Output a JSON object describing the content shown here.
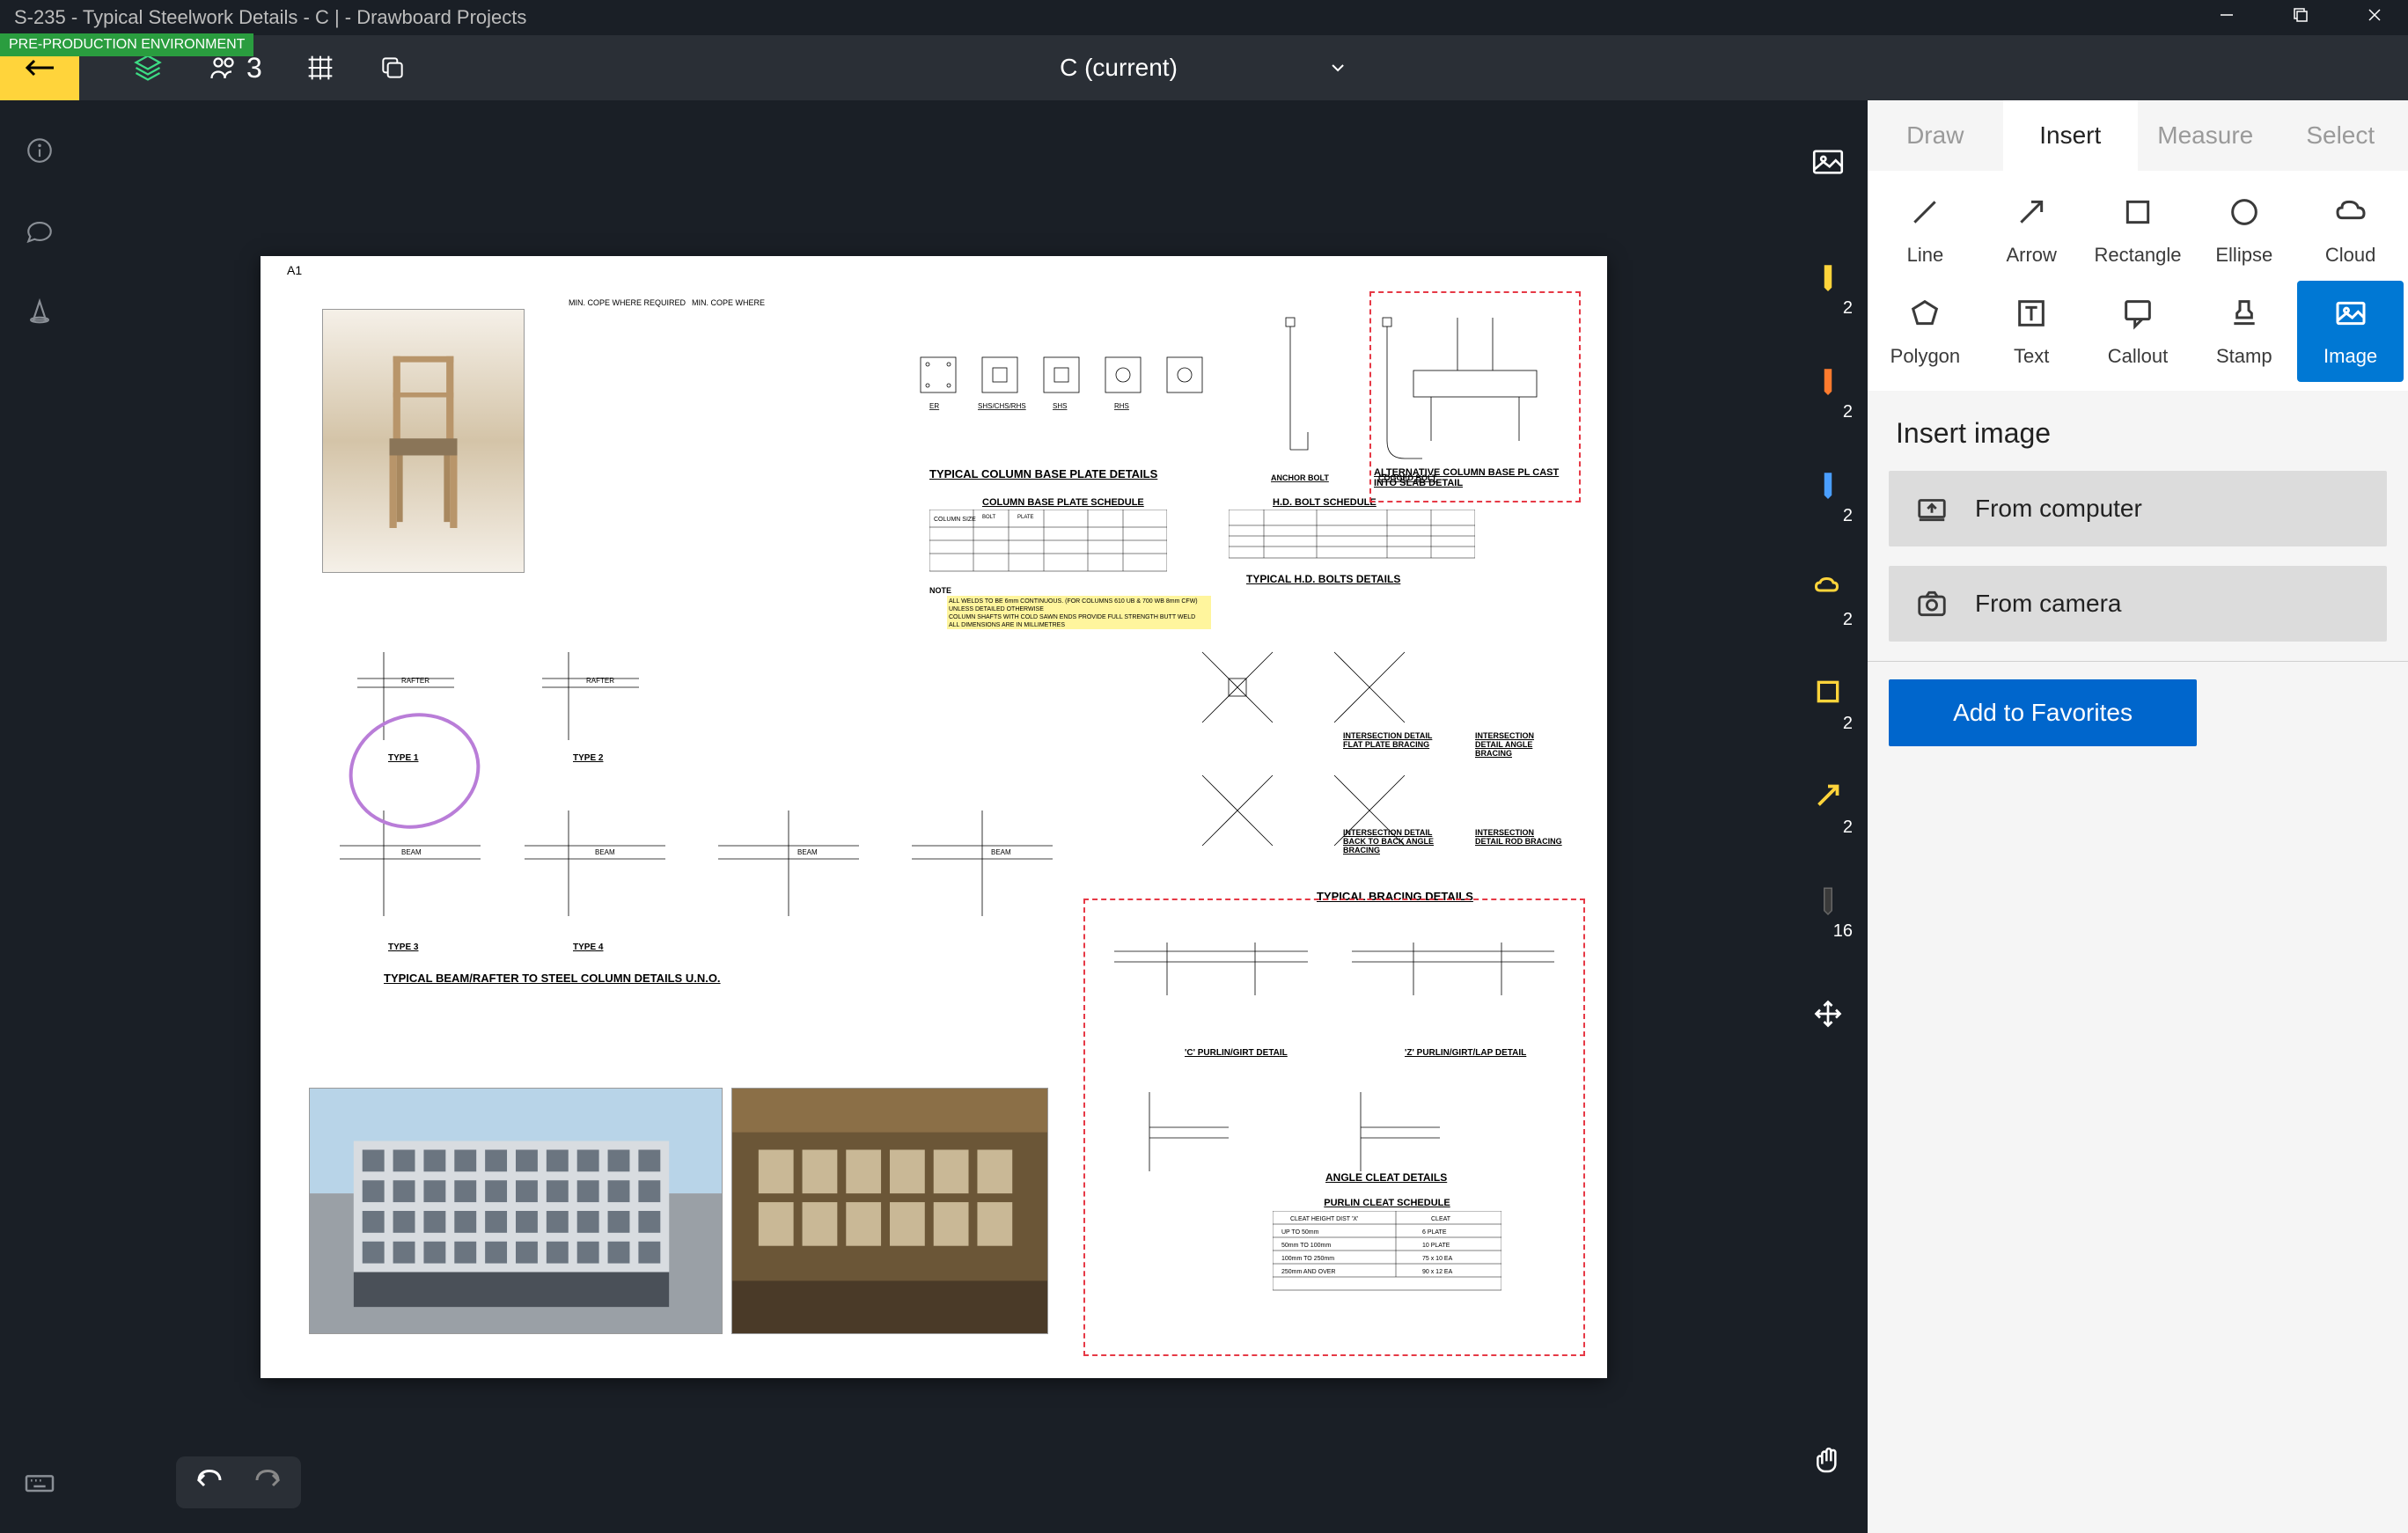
{
  "window_title": "S-235 - Typical Steelwork Details - C | - Drawboard Projects",
  "env_badge": "PRE-PRODUCTION ENVIRONMENT",
  "toolbar": {
    "layers_count": "",
    "comments_count": "3",
    "doc_selector": "C (current)"
  },
  "document": {
    "page_label": "A1",
    "titles": {
      "col_base": "TYPICAL COLUMN BASE PLATE DETAILS",
      "col_schedule": "COLUMN BASE PLATE SCHEDULE",
      "hd_schedule": "H.D. BOLT SCHEDULE",
      "hd_details": "TYPICAL H.D. BOLTS DETAILS",
      "alt_base": "ALTERNATIVE COLUMN BASE PL CAST INTO SLAB DETAIL",
      "anchor": "ANCHOR BOLT",
      "cogged": "COGGED BOLT",
      "intersection_flat": "INTERSECTION DETAIL FLAT PLATE BRACING",
      "intersection_angle": "INTERSECTION DETAIL ANGLE BRACING",
      "intersection_back": "INTERSECTION DETAIL BACK TO BACK ANGLE BRACING",
      "intersection_rod": "INTERSECTION DETAIL ROD BRACING",
      "bracing": "TYPICAL BRACING DETAILS",
      "beam_rafter": "TYPICAL BEAM/RAFTER TO STEEL COLUMN DETAILS U.N.O.",
      "purlin_girt_c": "'C' PURLIN/GIRT DETAIL",
      "purlin_girt_z": "'Z' PURLIN/GIRT/LAP DETAIL",
      "angle_cleat": "ANGLE CLEAT DETAILS",
      "purlin_schedule": "PURLIN CLEAT SCHEDULE",
      "notes": "NOTE",
      "type1": "TYPE 1",
      "type2": "TYPE 2",
      "type3": "TYPE 3",
      "type4": "TYPE 4"
    }
  },
  "annotation_tools": [
    {
      "name": "yellow-highlighter",
      "color": "#ffd43b",
      "count": "2"
    },
    {
      "name": "orange-highlighter",
      "color": "#ff7b2e",
      "count": "2"
    },
    {
      "name": "blue-pen",
      "color": "#4a9eff",
      "count": "2"
    },
    {
      "name": "yellow-cloud",
      "color": "#ffd43b",
      "count": "2"
    },
    {
      "name": "yellow-rect",
      "color": "#ffd43b",
      "count": "2"
    },
    {
      "name": "yellow-arrow",
      "color": "#ffd43b",
      "count": "2"
    },
    {
      "name": "black-pen",
      "color": "#3a3a3a",
      "count": "16"
    }
  ],
  "panel": {
    "tabs": {
      "draw": "Draw",
      "insert": "Insert",
      "measure": "Measure",
      "select": "Select"
    },
    "tools": {
      "line": "Line",
      "arrow": "Arrow",
      "rectangle": "Rectangle",
      "ellipse": "Ellipse",
      "cloud": "Cloud",
      "polygon": "Polygon",
      "text": "Text",
      "callout": "Callout",
      "stamp": "Stamp",
      "image": "Image"
    },
    "section_title": "Insert image",
    "from_computer": "From computer",
    "from_camera": "From camera",
    "add_favorites": "Add to Favorites"
  }
}
